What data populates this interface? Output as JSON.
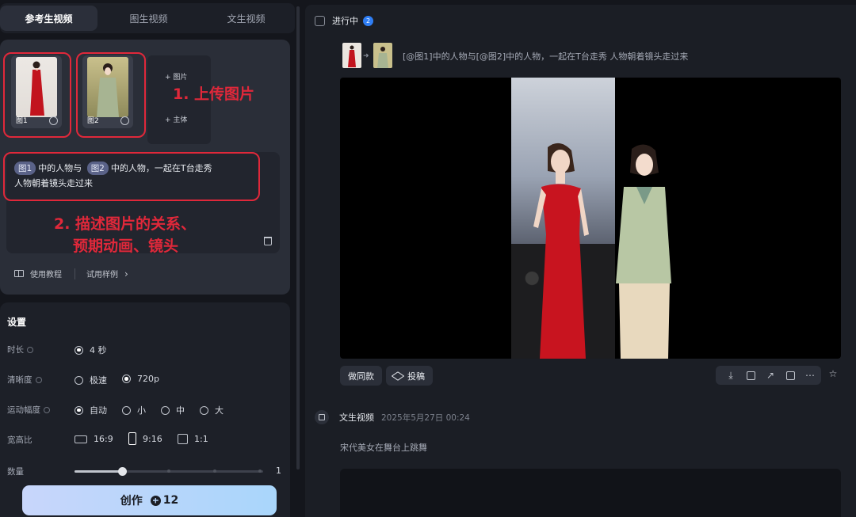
{
  "tabs": [
    {
      "label": "参考生视频",
      "active": true
    },
    {
      "label": "图生视频",
      "active": false
    },
    {
      "label": "文生视频",
      "active": false
    }
  ],
  "upload": {
    "images": [
      {
        "label": "图1"
      },
      {
        "label": "图2"
      }
    ],
    "add_image_label": "+ 图片",
    "add_subject_label": "+ 主体",
    "annotation_1": "1. 上传图片",
    "annotation_2_line1": "2. 描述图片的关系、",
    "annotation_2_line2": "预期动画、镜头"
  },
  "prompt": {
    "chip1": "图1",
    "text1": "中的人物与",
    "chip2": "图2",
    "text2": "中的人物，一起在T台走秀",
    "line2": "人物朝着镜头走过来"
  },
  "helpers": {
    "tutorial": "使用教程",
    "sample": "试用样例"
  },
  "settings": {
    "title": "设置",
    "duration_label": "时长",
    "duration_option": "4 秒",
    "clarity_label": "清晰度",
    "clarity_options": [
      "极速",
      "720p"
    ],
    "motion_label": "运动幅度",
    "motion_options": [
      "自动",
      "小",
      "中",
      "大"
    ],
    "ratio_label": "宽高比",
    "ratio_options": [
      "16:9",
      "9:16",
      "1:1"
    ],
    "quantity_label": "数量",
    "quantity_value": "1",
    "quantity_fraction": 0.25
  },
  "create": {
    "label": "创作",
    "cost": "12"
  },
  "right": {
    "in_progress_label": "进行中",
    "in_progress_count": "2",
    "ref_text": "[@图1]中的人物与[@图2]中的人物，一起在T台走秀 人物朝着镜头走过来",
    "same_style_button": "做同款",
    "submit_button": "投稿",
    "item2_type": "文生视频",
    "item2_date": "2025年5月27日 00:24",
    "item2_prompt": "宋代美女在舞台上跳舞"
  },
  "colors": {
    "annotation_red": "#e0283a",
    "badge_blue": "#2f7ef5",
    "create_gradient_start": "#c8d6fb",
    "create_gradient_end": "#a9d6fb"
  }
}
